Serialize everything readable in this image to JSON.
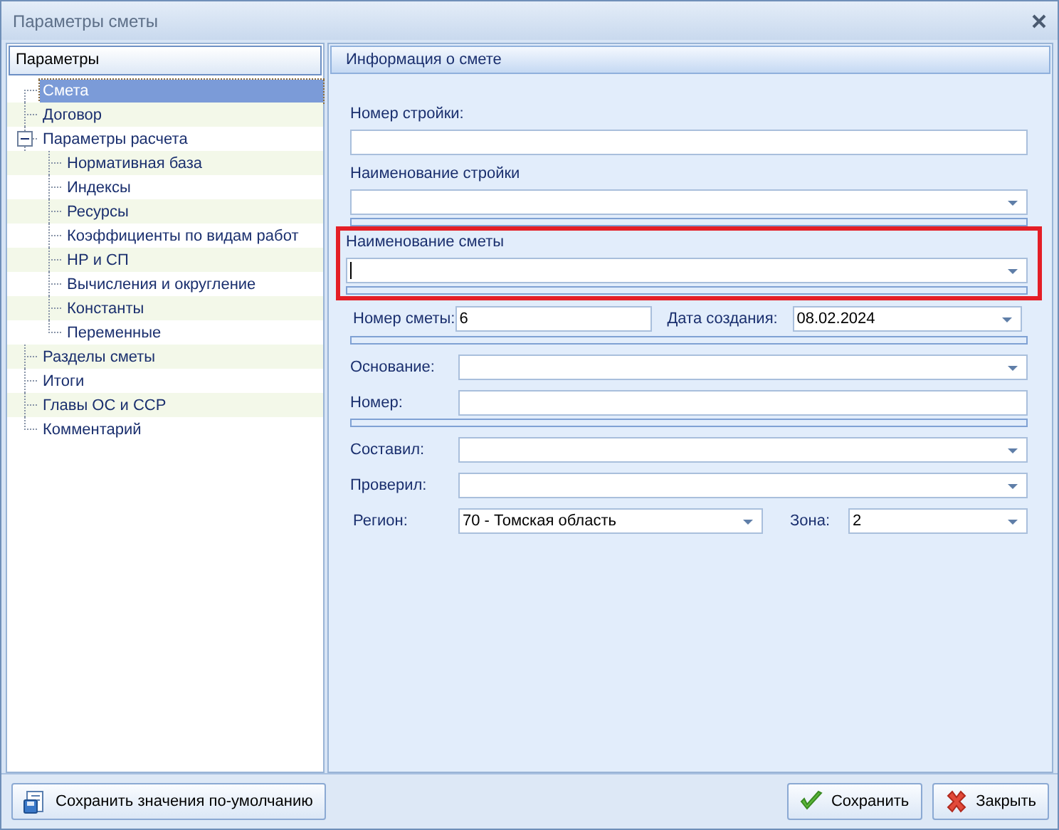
{
  "window": {
    "title": "Параметры сметы"
  },
  "sidebar": {
    "header": "Параметры",
    "items": [
      {
        "label": "Смета",
        "selected": true
      },
      {
        "label": "Договор",
        "selected": false
      },
      {
        "label": "Параметры расчета",
        "selected": false,
        "expanded": true,
        "children": [
          {
            "label": "Нормативная база",
            "selected": false
          },
          {
            "label": "Индексы",
            "selected": false
          },
          {
            "label": "Ресурсы",
            "selected": false
          },
          {
            "label": "Коэффициенты по видам работ",
            "selected": false
          },
          {
            "label": "НР и СП",
            "selected": false
          },
          {
            "label": "Вычисления и округление",
            "selected": false
          },
          {
            "label": "Константы",
            "selected": false
          },
          {
            "label": "Переменные",
            "selected": false
          }
        ]
      },
      {
        "label": "Разделы сметы",
        "selected": false
      },
      {
        "label": "Итоги",
        "selected": false
      },
      {
        "label": "Главы ОС и ССР",
        "selected": false
      },
      {
        "label": "Комментарий",
        "selected": false
      }
    ]
  },
  "panel": {
    "title": "Информация о смете",
    "rows": [
      {
        "kind": "stacked",
        "label": "Номер стройки:",
        "field": {
          "kind": "text",
          "focused": false
        }
      },
      {
        "kind": "stacked",
        "label": "Наименование стройки",
        "field": {
          "kind": "combo",
          "focused": false
        }
      },
      {
        "kind": "separator"
      },
      {
        "kind": "highlight",
        "rows": [
          {
            "kind": "stacked",
            "label": "Наименование сметы",
            "field": {
              "kind": "combo",
              "focused": true
            }
          },
          {
            "kind": "separator"
          }
        ]
      },
      {
        "kind": "pair",
        "items": [
          {
            "label": "Номер сметы:",
            "field": {
              "kind": "text",
              "value": "6",
              "focused": false
            }
          },
          {
            "label": "Дата создания:",
            "field": {
              "kind": "combo",
              "value": "08.02.2024",
              "focused": false
            }
          }
        ]
      },
      {
        "kind": "separator"
      },
      {
        "kind": "inline",
        "label": "Основание:",
        "field": {
          "kind": "combo",
          "focused": false
        }
      },
      {
        "kind": "inline",
        "label": "Номер:",
        "field": {
          "kind": "text",
          "focused": false
        }
      },
      {
        "kind": "separator"
      },
      {
        "kind": "inline",
        "label": "Составил:",
        "field": {
          "kind": "combo",
          "focused": false
        }
      },
      {
        "kind": "inline",
        "label": "Проверил:",
        "field": {
          "kind": "combo",
          "focused": false
        }
      },
      {
        "kind": "pair",
        "items": [
          {
            "label": "Регион:",
            "field": {
              "kind": "combo",
              "value": "70 - Томская область",
              "focused": false
            }
          },
          {
            "label": "Зона:",
            "field": {
              "kind": "combo",
              "value": "2",
              "focused": false
            }
          }
        ]
      }
    ]
  },
  "buttons": [
    {
      "label": "Сохранить значения по-умолчанию",
      "kind": "defaults"
    },
    {
      "label": "Сохранить",
      "kind": "save"
    },
    {
      "label": "Закрыть",
      "kind": "close"
    }
  ]
}
